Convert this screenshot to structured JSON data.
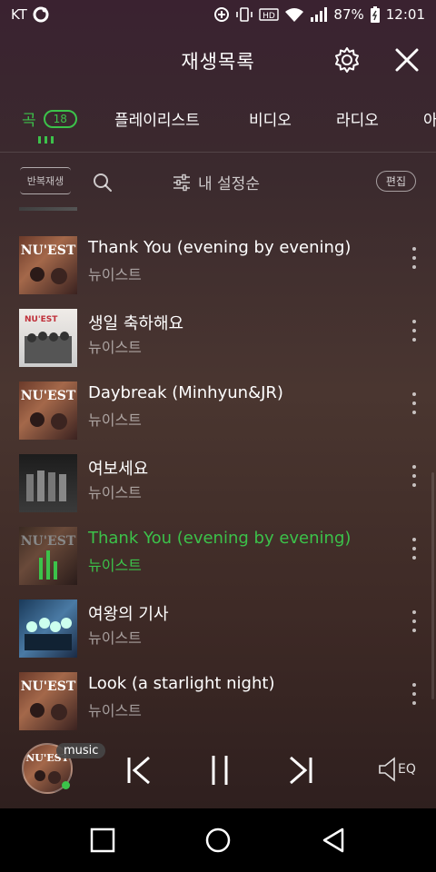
{
  "status": {
    "carrier": "KT",
    "battery": "87%",
    "time": "12:01"
  },
  "header": {
    "title": "재생목록"
  },
  "tabs": [
    {
      "label": "곡",
      "count": "18",
      "active": true
    },
    {
      "label": "플레이리스트"
    },
    {
      "label": "비디오"
    },
    {
      "label": "라디오"
    },
    {
      "label": "아"
    }
  ],
  "toolbar": {
    "repeat_label": "반복재생",
    "sort_label": "내 설정순",
    "edit_label": "편집"
  },
  "songs": [
    {
      "title": "Thank You (evening by evening)",
      "artist": "뉴이스트",
      "playing": false
    },
    {
      "title": "생일 축하해요",
      "artist": "뉴이스트",
      "playing": false
    },
    {
      "title": "Daybreak (Minhyun&JR)",
      "artist": "뉴이스트",
      "playing": false
    },
    {
      "title": "여보세요",
      "artist": "뉴이스트",
      "playing": false
    },
    {
      "title": "Thank You (evening by evening)",
      "artist": "뉴이스트",
      "playing": true
    },
    {
      "title": "여왕의 기사",
      "artist": "뉴이스트",
      "playing": false
    },
    {
      "title": "Look (a starlight night)",
      "artist": "뉴이스트",
      "playing": false
    }
  ],
  "player": {
    "badge": "music",
    "eq_label": "EQ"
  },
  "colors": {
    "accent": "#3cc24a"
  }
}
